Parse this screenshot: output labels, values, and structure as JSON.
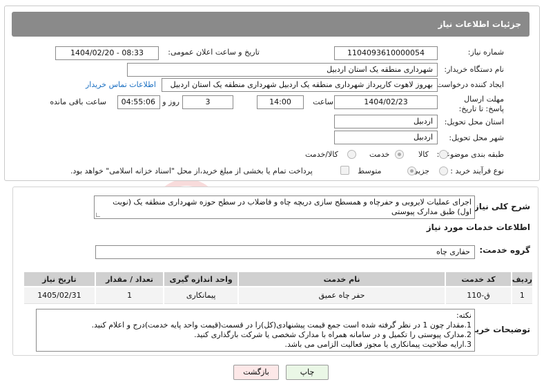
{
  "header": {
    "title": "جزئیات اطلاعات نیاز"
  },
  "form": {
    "need_number_label": "شماره نیاز:",
    "need_number": "1104093610000054",
    "announce_label": "تاریخ و ساعت اعلان عمومی:",
    "announce_value": "1404/02/20 - 08:33",
    "buyer_org_label": "نام دستگاه خریدار:",
    "buyer_org": "شهرداری منطقه یک استان اردبیل",
    "requester_label": "ایجاد کننده درخواست:",
    "requester": "بهروز لاهوت کارپرداز شهرداری منطقه یک اردبیل شهرداری منطقه یک استان اردبیل",
    "contact_link": "اطلاعات تماس خریدار",
    "deadline_label": "مهلت ارسال پاسخ: تا تاریخ:",
    "deadline_date": "1404/02/23",
    "time_label": "ساعت",
    "deadline_time": "14:00",
    "days_value": "3",
    "days_label": "روز و",
    "remaining_value": "04:55:06",
    "remaining_label": "ساعت باقی مانده",
    "province_label": "استان محل تحویل:",
    "province": "اردبیل",
    "city_label": "شهر محل تحویل:",
    "city": "اردبیل",
    "category_label": "طبقه بندی موضوعی:",
    "category_options": [
      "کالا",
      "خدمت",
      "کالا/خدمت"
    ],
    "category_selected": "خدمت",
    "process_label": "نوع فرآیند خرید :",
    "process_options": [
      "جزیی",
      "متوسط"
    ],
    "process_selected": "متوسط",
    "payment_note": "پرداخت تمام یا بخشی از مبلغ خرید،از محل \"اسناد خزانه اسلامی\" خواهد بود."
  },
  "details": {
    "summary_label": "شرح کلی نیاز:",
    "summary_text": "اجرای عملیات لایروبی و حفرچاه و همسطح سازی دریچه چاه و فاضلاب در سطح حوزه شهرداری منطقه یک (نوبت اول) طبق مدارک پیوستی",
    "services_heading": "اطلاعات خدمات مورد نیاز",
    "service_group_label": "گروه خدمت:",
    "service_group": "حفاری چاه",
    "table": {
      "headers": [
        "ردیف",
        "کد خدمت",
        "نام خدمت",
        "واحد اندازه گیری",
        "تعداد / مقدار",
        "تاریخ نیاز"
      ],
      "rows": [
        [
          "1",
          "ق-110",
          "حفر چاه عمیق",
          "پیمانکاری",
          "1",
          "1405/02/31"
        ]
      ]
    },
    "buyer_notes_label": "توضیحات خریدار:",
    "buyer_notes": [
      "نکته:",
      "1.مقدار چون 1 در نظر گرفته شده است جمع قیمت پیشنهادی(کل)را در قسمت(قیمت واحد پایه خدمت)درج و اعلام کنید.",
      "2.مدارک پیوستی را تکمیل و در سامانه همراه با مدارک شخصی یا شرکت بارگذاری کنید.",
      "3.ارایه صلاحیت پیمانکاری یا مجوز فعالیت الزامی می باشد."
    ]
  },
  "buttons": {
    "print": "چاپ",
    "back": "بازگشت"
  },
  "colors": {
    "header_bg": "#8a8a8a",
    "link": "#1a6fc2",
    "print_bg": "#eaf7e6",
    "back_bg": "#fde8e8"
  }
}
